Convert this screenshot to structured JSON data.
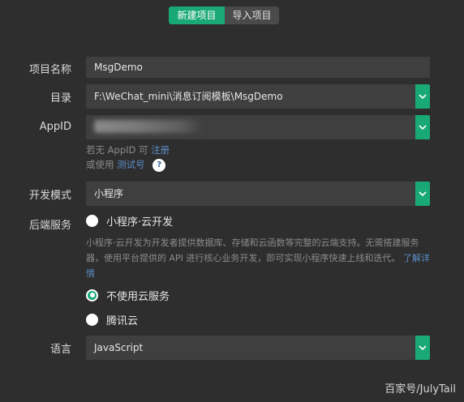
{
  "tabs": {
    "new_project": "新建项目",
    "import_project": "导入项目"
  },
  "project_name": {
    "label": "项目名称",
    "value": "MsgDemo"
  },
  "directory": {
    "label": "目录",
    "value": "F:\\WeChat_mini\\消息订阅模板\\MsgDemo"
  },
  "appid": {
    "label": "AppID",
    "hint_prefix": "若无 AppID 可",
    "hint_register": "注册",
    "hint_or": "或使用",
    "hint_test_id": "测试号",
    "help_glyph": "?"
  },
  "dev_mode": {
    "label": "开发模式",
    "value": "小程序"
  },
  "backend": {
    "label": "后端服务",
    "options": [
      {
        "label": "小程序·云开发",
        "checked": false
      },
      {
        "label": "不使用云服务",
        "checked": true
      },
      {
        "label": "腾讯云",
        "checked": false
      }
    ],
    "cloud_desc": "小程序·云开发为开发者提供数据库、存储和云函数等完整的云端支持。无需搭建服务器，使用平台提供的 API 进行核心业务开发，即可实现小程序快速上线和迭代。",
    "learn_more": "了解详情"
  },
  "language": {
    "label": "语言",
    "value": "JavaScript"
  },
  "watermark": "百家号/JulyTail",
  "colors": {
    "accent": "#19a974",
    "background": "#2e2e2e",
    "field": "#3f3f3f",
    "link": "#5b8cc7"
  }
}
